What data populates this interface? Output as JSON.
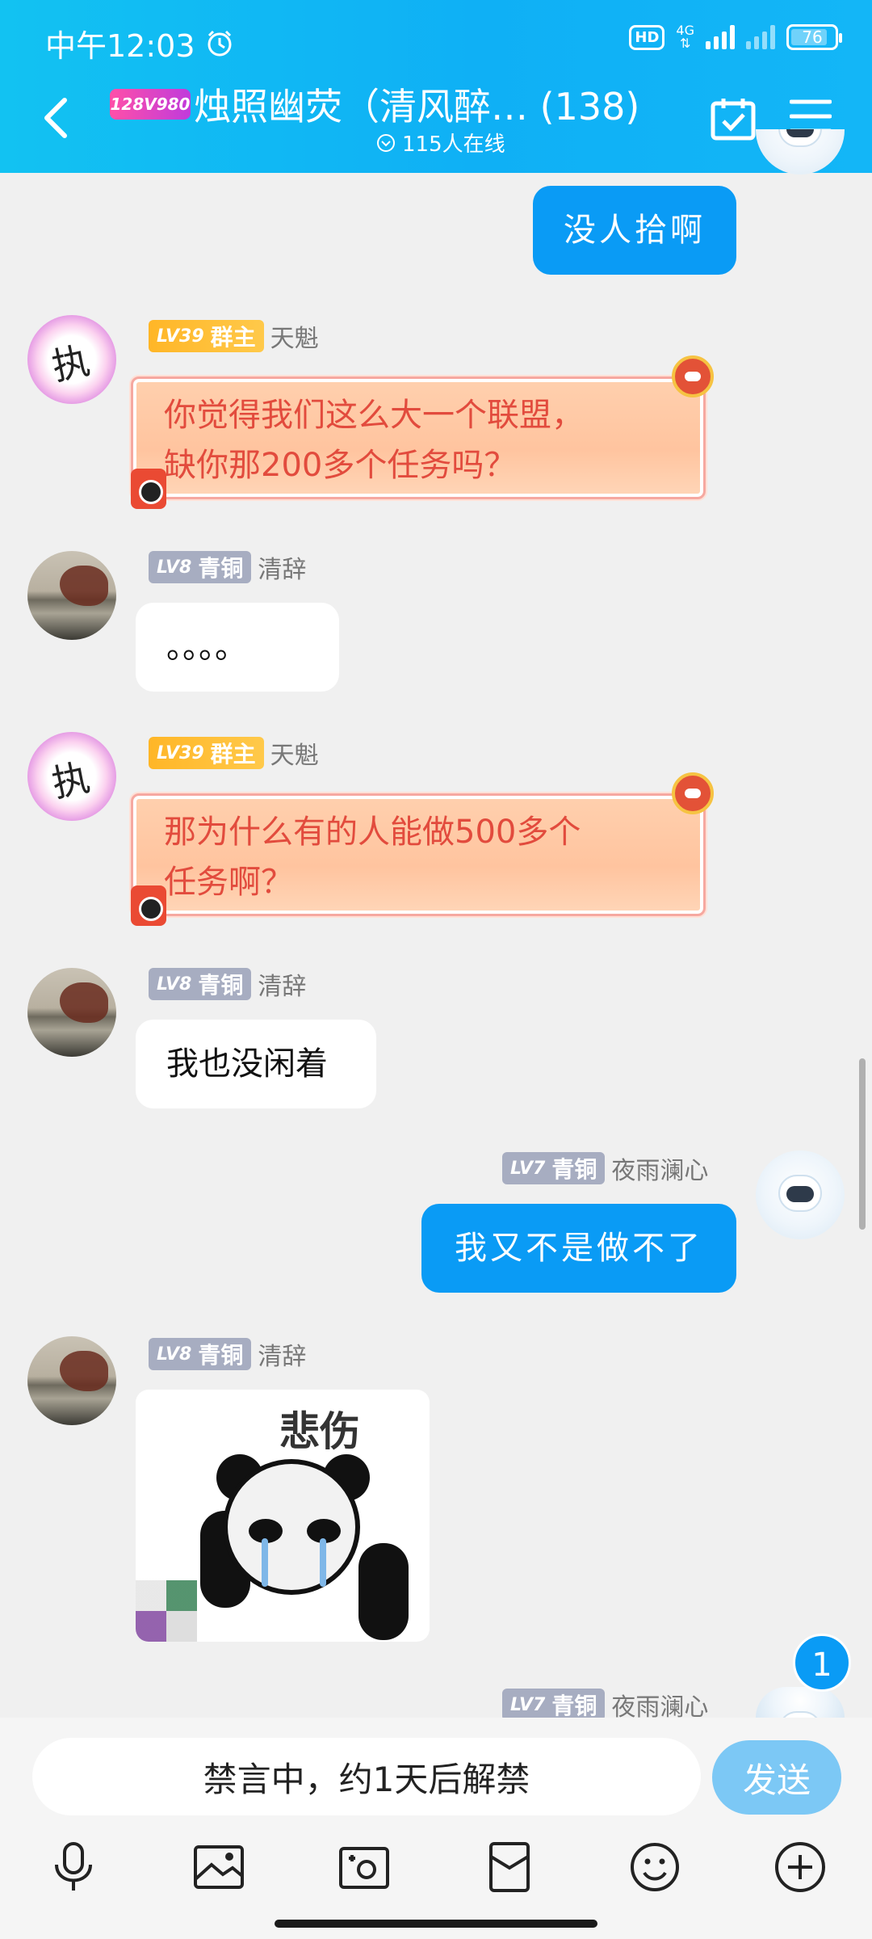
{
  "status_bar": {
    "time": "中午12:03",
    "hd": "HD",
    "network": "4G",
    "battery": "76"
  },
  "header": {
    "group_tag": "128V980",
    "title": "烛照幽荧（清风醉… (138)",
    "online": "115人在线"
  },
  "messages": [
    {
      "side": "right",
      "text": "没人拾啊"
    },
    {
      "side": "left",
      "level": "LV39",
      "role": "群主",
      "nick": "天魁",
      "text_lines": [
        "你觉得我们这么大一个联盟，",
        "缺你那200多个任务吗？"
      ]
    },
    {
      "side": "left",
      "level": "LV8",
      "role": "青铜",
      "nick": "清辞",
      "text": "。。。。"
    },
    {
      "side": "left",
      "level": "LV39",
      "role": "群主",
      "nick": "天魁",
      "text_lines": [
        "那为什么有的人能做500多个",
        "任务啊？"
      ]
    },
    {
      "side": "left",
      "level": "LV8",
      "role": "青铜",
      "nick": "清辞",
      "text": "我也没闲着"
    },
    {
      "side": "right",
      "level": "LV7",
      "role": "青铜",
      "nick": "夜雨澜心",
      "text": "我又不是做不了"
    },
    {
      "side": "left",
      "level": "LV8",
      "role": "青铜",
      "nick": "清辞",
      "sticker_caption": "悲伤"
    },
    {
      "side": "right",
      "level": "LV7",
      "role": "青铜",
      "nick": "夜雨澜心"
    }
  ],
  "unread_count": "1",
  "composer": {
    "placeholder": "禁言中，约1天后解禁",
    "send_label": "发送"
  },
  "toolbar_icons": [
    "microphone-icon",
    "image-icon",
    "camera-icon",
    "red-packet-icon",
    "emoji-icon",
    "plus-icon"
  ],
  "colors": {
    "header": "#12c2f2",
    "bubble_blue": "#0a9bf5",
    "owner_badge": "#ffb627",
    "bronze_badge": "#a7adc1"
  }
}
